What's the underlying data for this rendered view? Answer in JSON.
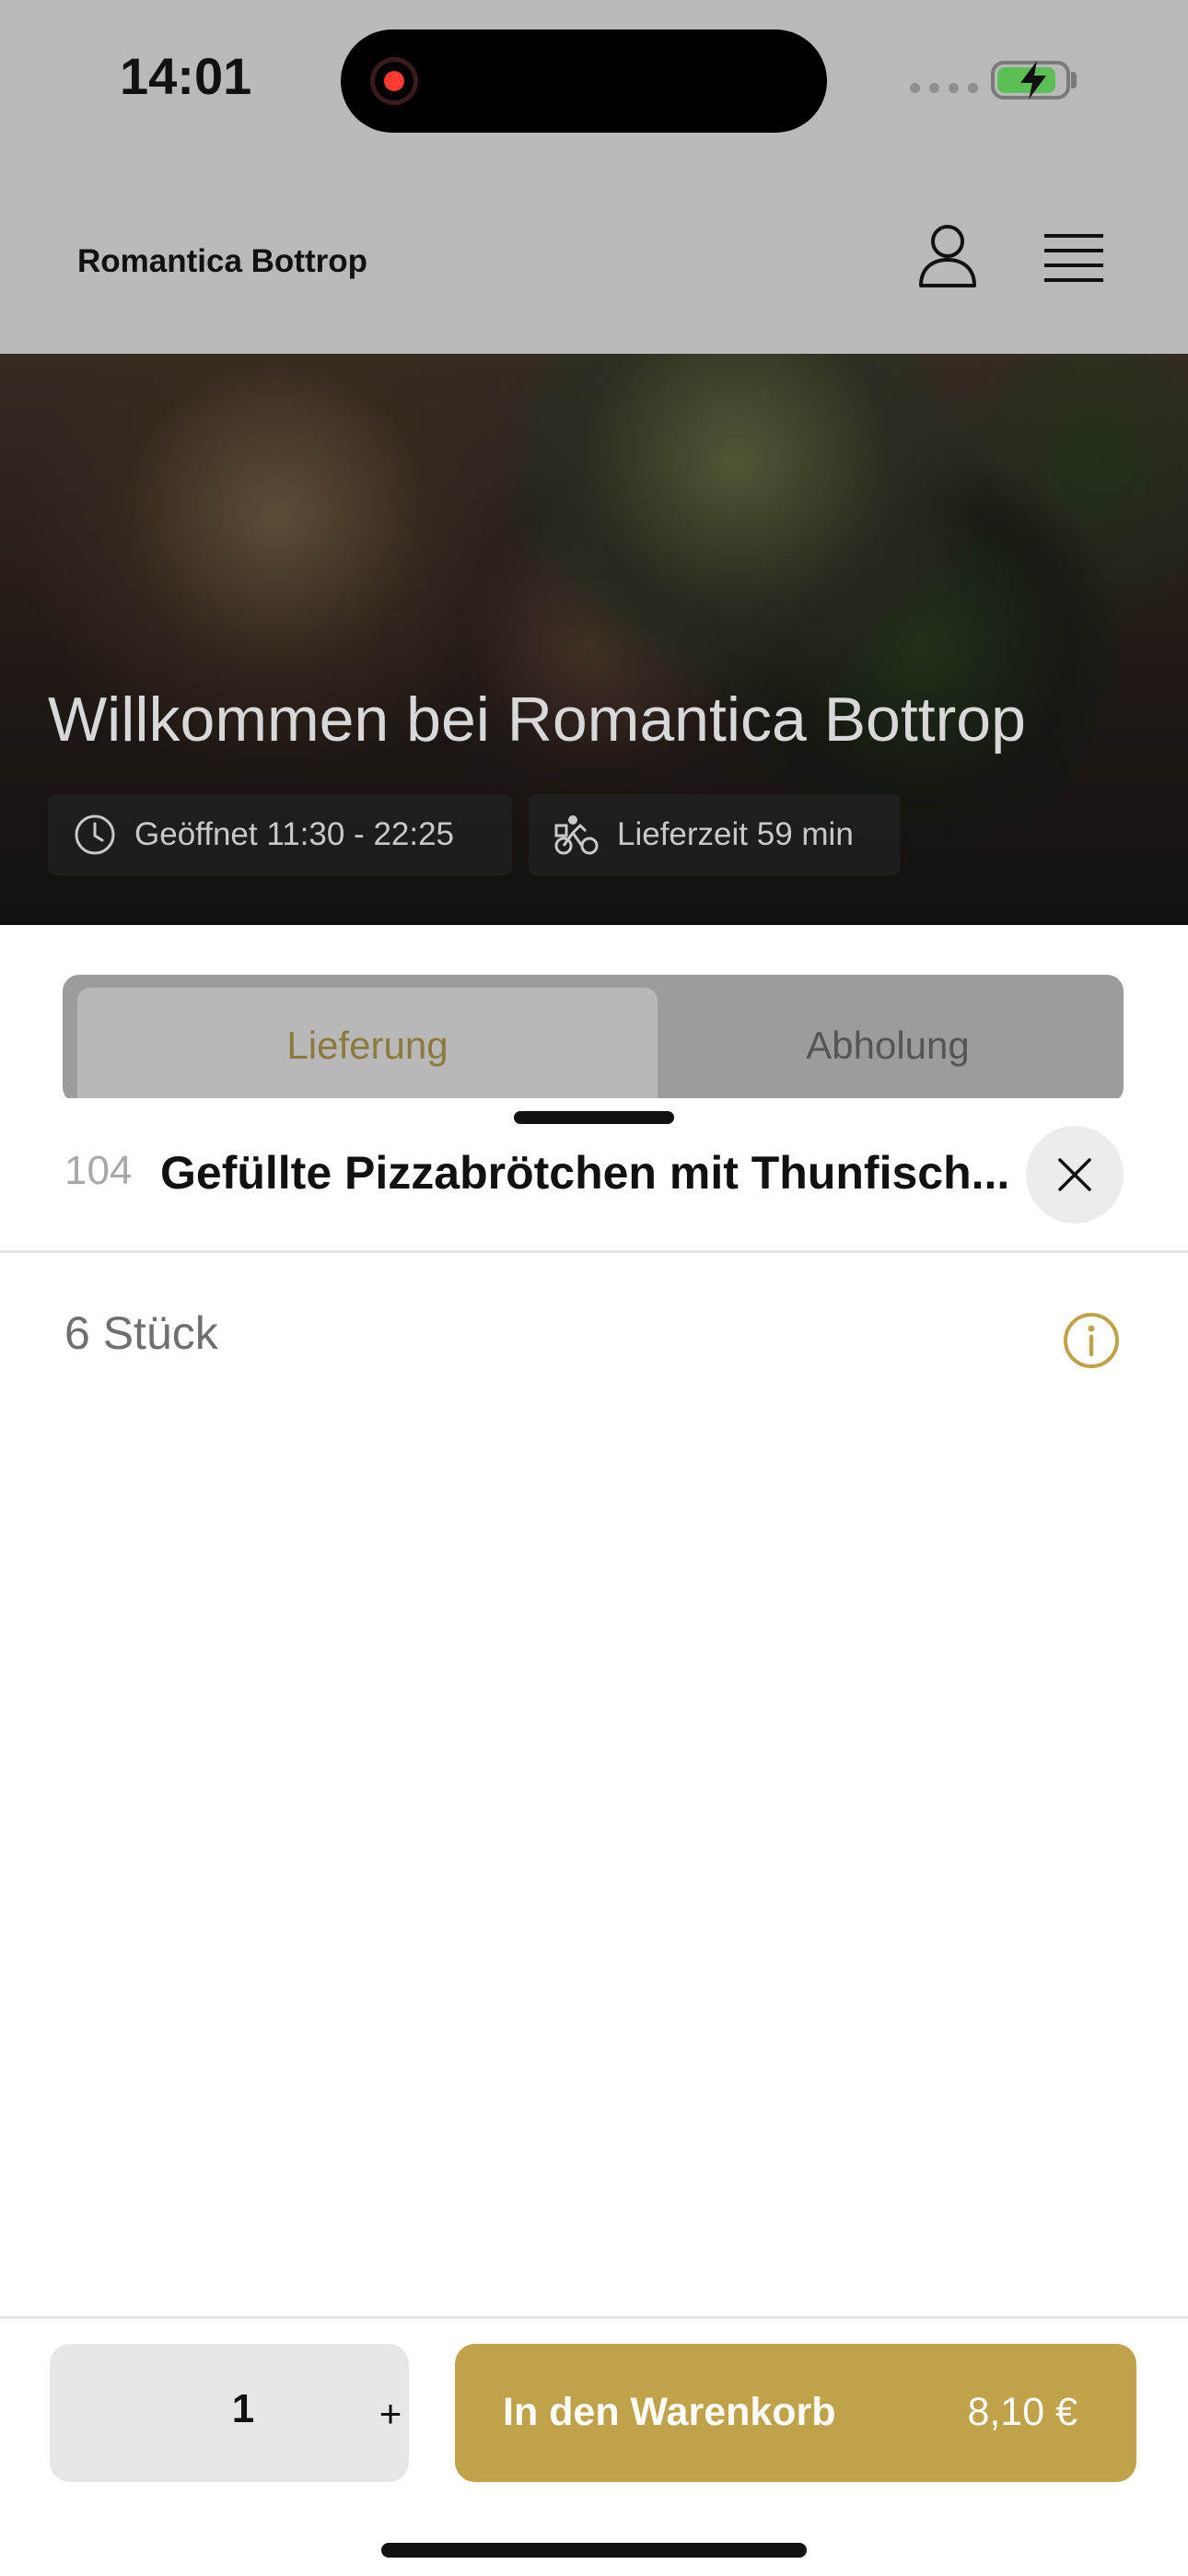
{
  "status_bar": {
    "time": "14:01",
    "recording_indicator": "record-icon",
    "battery": {
      "level": 0.85,
      "charging": true,
      "fill_color": "#5bbf55"
    }
  },
  "header": {
    "restaurant_name": "Romantica Bottrop",
    "profile_icon": "user-icon",
    "menu_icon": "hamburger-menu-icon"
  },
  "hero": {
    "title": "Willkommen bei Romantica Bottrop",
    "opening_hours": {
      "icon": "clock-icon",
      "label": "Geöffnet 11:30 - 22:25"
    },
    "delivery_time": {
      "icon": "bicycle-courier-icon",
      "label": "Lieferzeit 59 min"
    }
  },
  "order_mode": {
    "tabs": [
      {
        "label": "Lieferung",
        "selected": true
      },
      {
        "label": "Abholung",
        "selected": false
      }
    ],
    "accent_color": "#8c7a3c"
  },
  "item_sheet": {
    "number": "104",
    "title": "Gefüllte Pizzabrötchen mit Thunfisch...",
    "description": "6 Stück",
    "close_icon": "close-icon",
    "info_icon": "info-icon"
  },
  "purchase": {
    "quantity": "1",
    "increment_label": "+",
    "add_to_cart_label": "In den Warenkorb",
    "price": "8,10 €",
    "button_color": "#c0a24a"
  }
}
